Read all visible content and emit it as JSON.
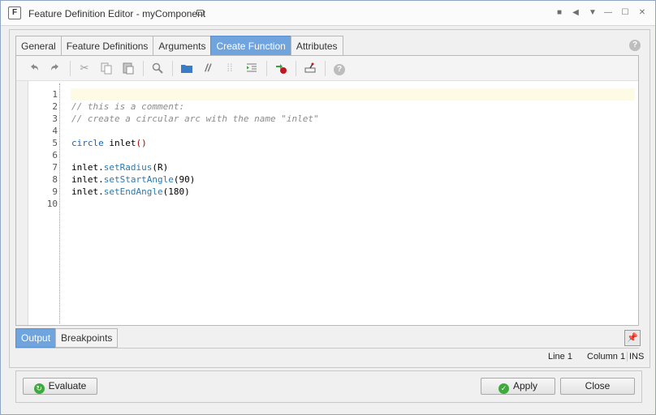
{
  "window": {
    "title": "Feature Definition Editor - myComponent",
    "app_icon_letter": "F"
  },
  "tabs": [
    {
      "label": "General",
      "active": false
    },
    {
      "label": "Feature Definitions",
      "active": false
    },
    {
      "label": "Arguments",
      "active": false
    },
    {
      "label": "Create Function",
      "active": true
    },
    {
      "label": "Attributes",
      "active": false
    }
  ],
  "help_icon": "?",
  "toolbar": {
    "icons": [
      "undo-icon",
      "redo-icon",
      "cut-icon",
      "copy-icon",
      "paste-icon",
      "find-icon",
      "toggle-bookmark-icon",
      "comment-icon",
      "uncomment-icon",
      "indent-icon",
      "insert-function-icon",
      "debug-icon",
      "help-icon"
    ]
  },
  "editor": {
    "line_numbers": [
      "1",
      "2",
      "3",
      "4",
      "5",
      "6",
      "7",
      "8",
      "9",
      "10"
    ],
    "lines": [
      "",
      "// this is a comment:",
      "// create a circular arc with the name \"inlet\"",
      "",
      "circle inlet()",
      "",
      "inlet.setRadius(R)",
      "inlet.setStartAngle(90)",
      "inlet.setEndAngle(180)",
      ""
    ]
  },
  "bottom_tabs": [
    {
      "label": "Output",
      "active": true
    },
    {
      "label": "Breakpoints",
      "active": false
    }
  ],
  "status": {
    "line": "Line 1",
    "column": "Column 1",
    "mode": "INS"
  },
  "buttons": {
    "evaluate": "Evaluate",
    "apply": "Apply",
    "close": "Close"
  },
  "colors": {
    "active_tab": "#6fa4df",
    "comment": "#8c8c8c",
    "keyword": "#1e62b0",
    "current_line": "#fdfbe4"
  }
}
